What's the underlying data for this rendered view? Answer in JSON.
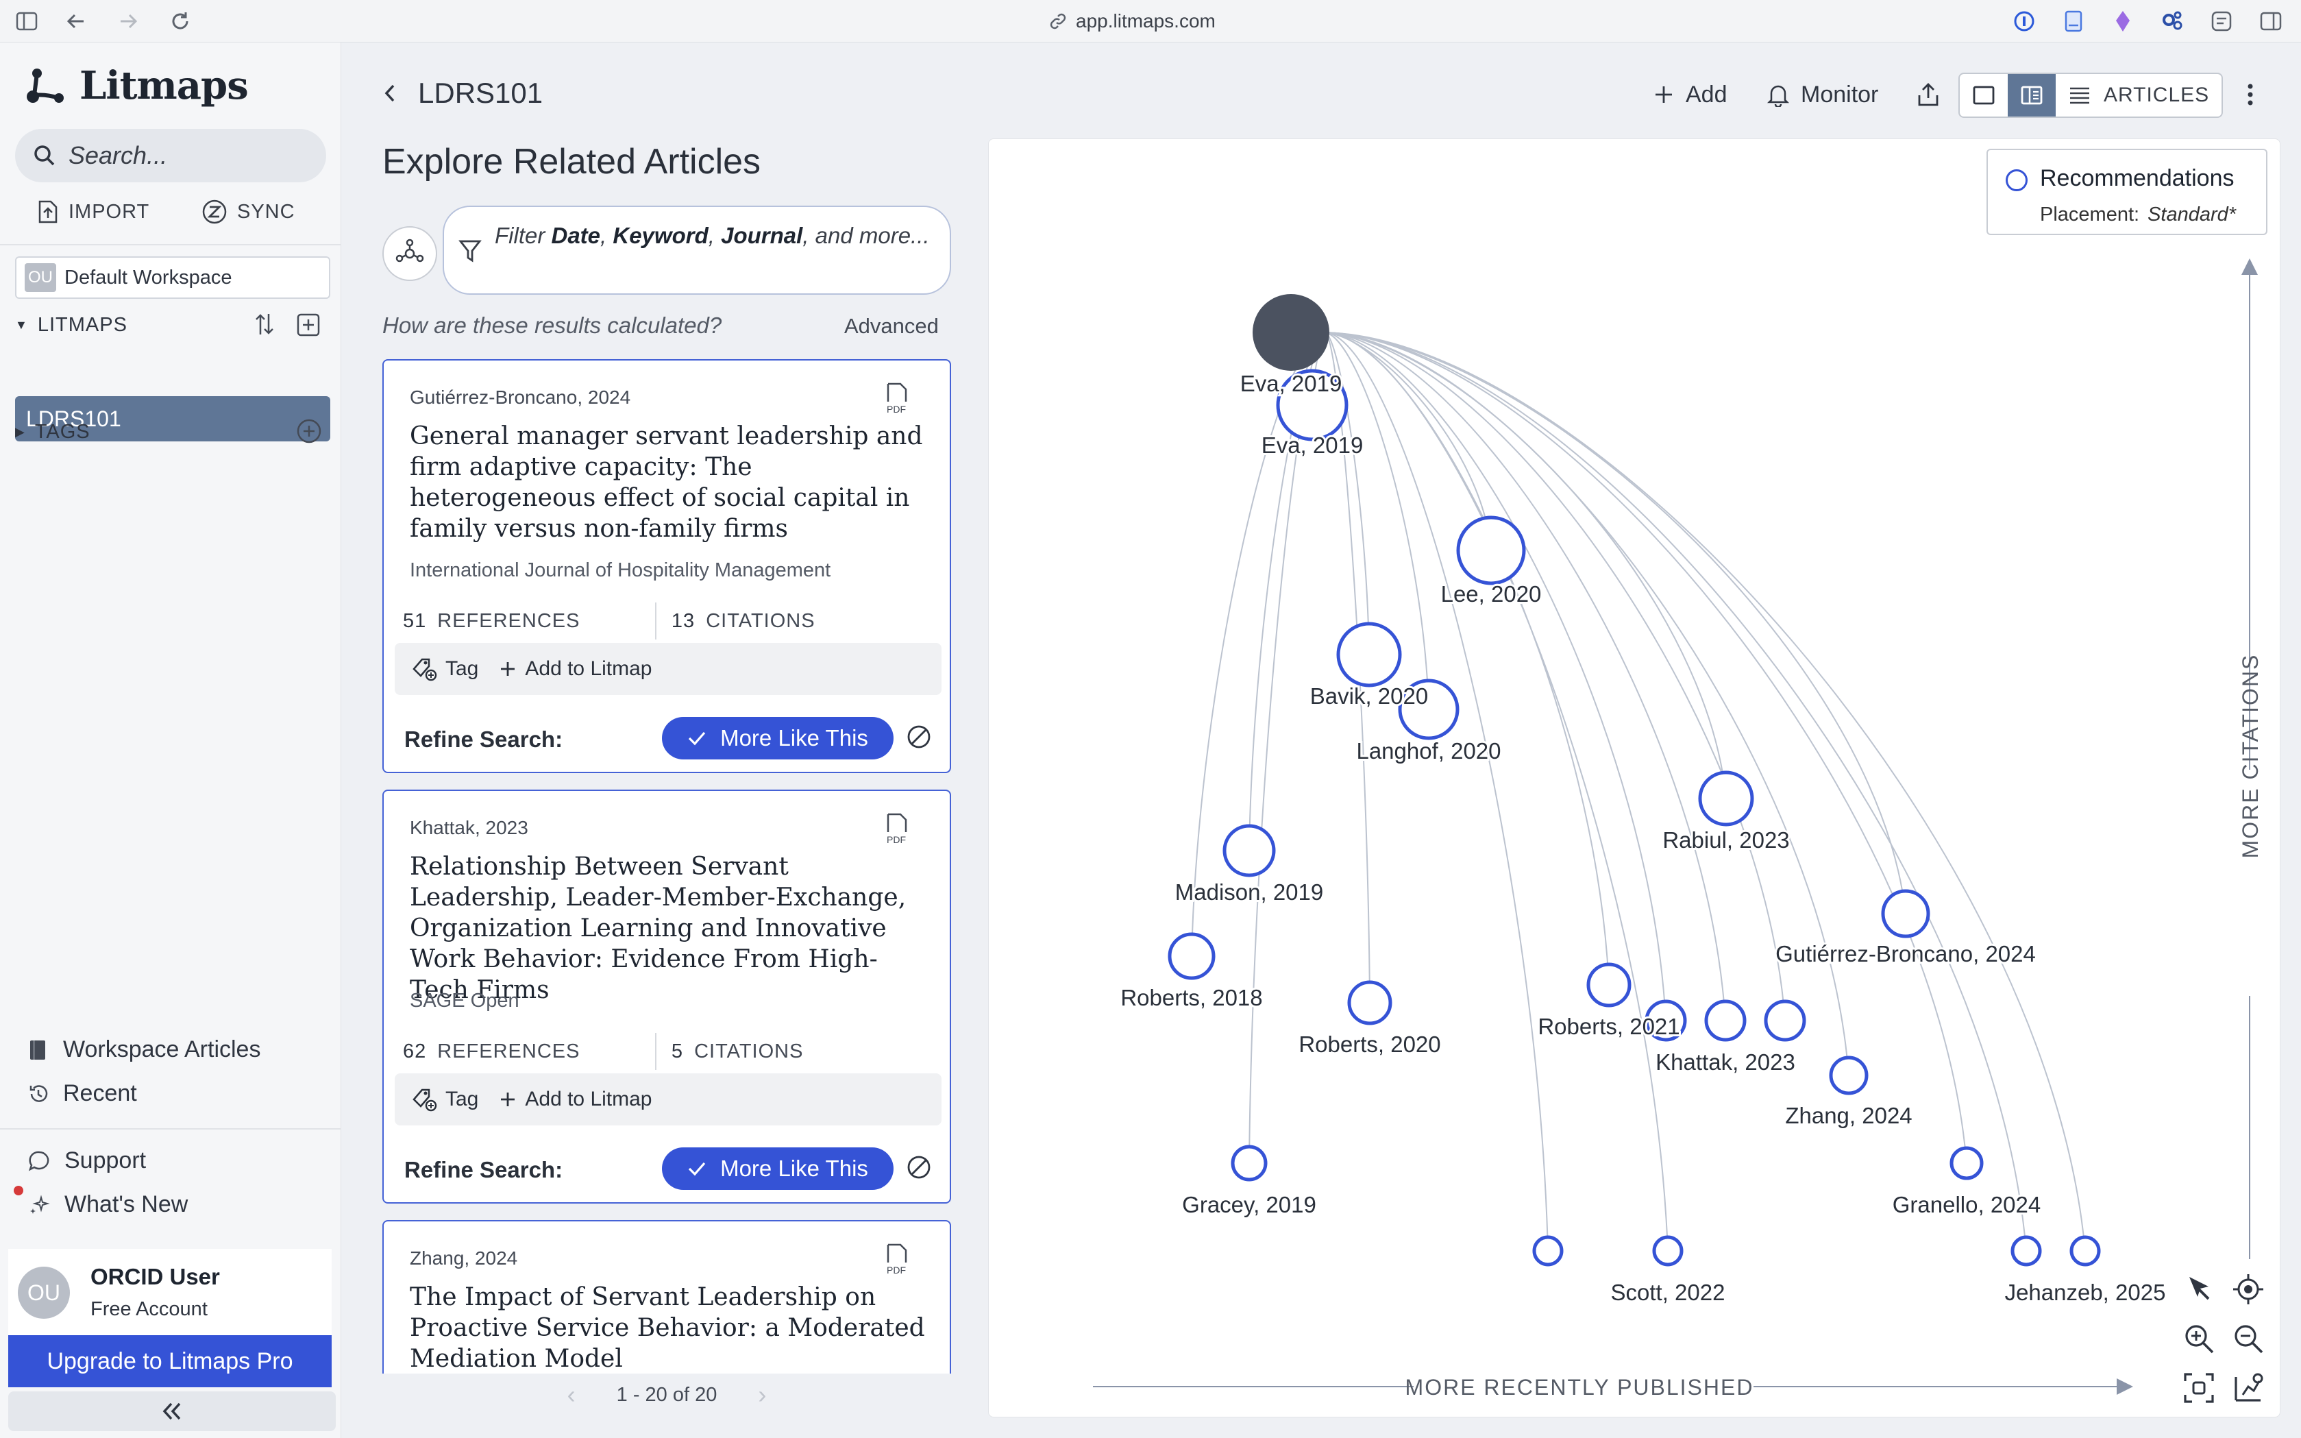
{
  "browser": {
    "url": "app.litmaps.com"
  },
  "sidebar": {
    "brand": "Litmaps",
    "search_placeholder": "Search...",
    "import_label": "IMPORT",
    "sync_label": "SYNC",
    "workspace_badge": "OU",
    "workspace_name": "Default Workspace",
    "litmaps_label": "LITMAPS",
    "active_litmap": "LDRS101",
    "tags_label": "TAGS",
    "workspace_articles": "Workspace Articles",
    "recent": "Recent",
    "support": "Support",
    "whats_new": "What's New",
    "user_initials": "OU",
    "user_name": "ORCID User",
    "user_plan": "Free Account",
    "upgrade_label": "Upgrade to Litmaps Pro"
  },
  "header": {
    "title": "LDRS101",
    "add_label": "Add",
    "monitor_label": "Monitor",
    "articles_label": "ARTICLES"
  },
  "explore": {
    "title": "Explore Related Articles",
    "filter_prefix": "Filter ",
    "filter_date": "Date",
    "filter_sep1": ", ",
    "filter_keyword": "Keyword",
    "filter_sep2": ", ",
    "filter_journal": "Journal",
    "filter_suffix": ", and more...",
    "calc_question": "How are these results calculated?",
    "advanced": "Advanced",
    "pagination": "1 - 20 of 20"
  },
  "results": [
    {
      "author_year": "Gutiérrez-Broncano, 2024",
      "title": "General manager servant leadership and firm adaptive capacity: The heterogeneous effect of social capital in family versus non-family firms",
      "journal": "International Journal of Hospitality Management",
      "references": "51",
      "references_label": "REFERENCES",
      "citations": "13",
      "citations_label": "CITATIONS",
      "tag_label": "Tag",
      "add_label": "Add to Litmap",
      "refine_label": "Refine Search:",
      "more_like_this": "More Like This"
    },
    {
      "author_year": "Khattak, 2023",
      "title": "Relationship Between Servant Leadership, Leader-Member-Exchange, Organization Learning and Innovative Work Behavior: Evidence From High-Tech Firms",
      "journal": "SAGE Open",
      "references": "62",
      "references_label": "REFERENCES",
      "citations": "5",
      "citations_label": "CITATIONS",
      "tag_label": "Tag",
      "add_label": "Add to Litmap",
      "refine_label": "Refine Search:",
      "more_like_this": "More Like This"
    },
    {
      "author_year": "Zhang, 2024",
      "title": "The Impact of Servant Leadership on Proactive Service Behavior: a Moderated Mediation Model"
    }
  ],
  "graph": {
    "legend_title": "Recommendations",
    "legend_placement_label": "Placement:",
    "legend_placement_value": "Standard*",
    "y_axis_label": "MORE CITATIONS",
    "x_axis_label": "MORE RECENTLY PUBLISHED",
    "seed_label": "Eva, 2019",
    "node_labels": [
      "Eva, 2019",
      "Lee, 2020",
      "Bavik, 2020",
      "Langhof, 2020",
      "Rabiul, 2023",
      "Madison, 2019",
      "Gutiérrez-Broncano, 2024",
      "Roberts, 2018",
      "Roberts, 2020",
      "Roberts, 2021",
      "Khattak, 2023",
      "Zhang, 2024",
      "Gracey, 2019",
      "Granello, 2024",
      "Scott, 2022",
      "Jehanzeb, 2025"
    ],
    "accent": "#3553d6",
    "seed_color": "#4b5260"
  }
}
